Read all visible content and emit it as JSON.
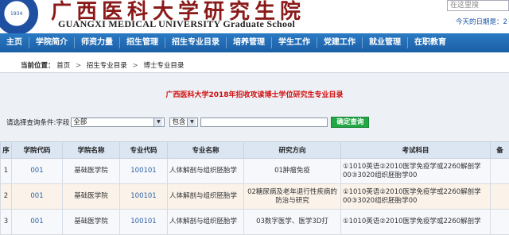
{
  "header": {
    "seal_year": "1934",
    "brand_cn": "广西医科大学研究生院",
    "brand_en": "GUANGXI MEDICAL UNIVERSITY Graduate School",
    "search_placeholder": "在这里搜",
    "today_label": "今天的日期是：",
    "today_value": "2"
  },
  "nav": [
    "主页",
    "学院简介",
    "师资力量",
    "招生管理",
    "招生专业目录",
    "培养管理",
    "学生工作",
    "党建工作",
    "就业管理",
    "在职教育"
  ],
  "breadcrumb": {
    "label": "当前位置：",
    "items": [
      "首页",
      "招生专业目录",
      "博士专业目录"
    ],
    "sep": ">"
  },
  "page_title": "广西医科大学2018年招收攻读博士学位研究生专业目录",
  "filter": {
    "prompt": "请选择查询条件:",
    "field_label": "字段",
    "field_value": "全部",
    "match_value": "包含",
    "query_value": "",
    "button": "确定查询"
  },
  "table": {
    "headers": [
      "序",
      "学院代码",
      "学院名称",
      "专业代码",
      "专业名称",
      "研究方向",
      "考试科目",
      "备"
    ],
    "rows": [
      [
        "1",
        "001",
        "基础医学院",
        "100101",
        "人体解剖与组织胚胎学",
        "01肿瘤免疫",
        "①1010英语②2010医学免疫学或2260解剖学00③3020组织胚胎学00",
        ""
      ],
      [
        "2",
        "001",
        "基础医学院",
        "100101",
        "人体解剖与组织胚胎学",
        "02糖尿病及老年退行性疾病的防治与研究",
        "①1010英语②2010医学免疫学或2260解剖学00③3020组织胚胎学00",
        ""
      ],
      [
        "3",
        "001",
        "基础医学院",
        "100101",
        "人体解剖与组织胚胎学",
        "03数字医学、医学3D打",
        "①1010英语②2010医学免疫学或2260解剖学",
        ""
      ]
    ]
  },
  "colors": {
    "nav_bg": "#1b5fa6",
    "title_red": "#d01010",
    "button_green": "#22a744",
    "brand_red": "#8a1a1a"
  }
}
